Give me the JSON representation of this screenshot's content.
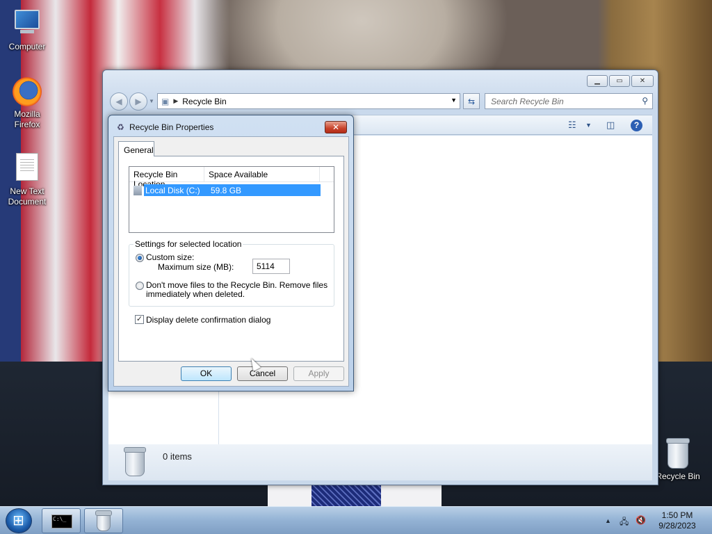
{
  "desktop": {
    "icons": [
      {
        "label": "Computer"
      },
      {
        "label": "Mozilla Firefox"
      },
      {
        "label": "New Text Document"
      },
      {
        "label": "Recycle Bin"
      }
    ]
  },
  "explorer": {
    "address": "Recycle Bin",
    "search_placeholder": "Search Recycle Bin",
    "details": {
      "count": "0 items"
    }
  },
  "dialog": {
    "title": "Recycle Bin Properties",
    "tab": "General",
    "list": {
      "headers": [
        "Recycle Bin Location",
        "Space Available"
      ],
      "rows": [
        {
          "location": "Local Disk (C:)",
          "space": "59.8 GB"
        }
      ]
    },
    "group_label": "Settings for selected location",
    "custom_size_label": "Custom size:",
    "max_size_label": "Maximum size (MB):",
    "max_size_value": "5114",
    "dont_move_label_1": "Don't move files to the Recycle Bin. Remove files",
    "dont_move_label_2": "immediately when deleted.",
    "confirm_label": "Display delete confirmation dialog",
    "buttons": {
      "ok": "OK",
      "cancel": "Cancel",
      "apply": "Apply"
    }
  },
  "taskbar": {
    "time": "1:50 PM",
    "date": "9/28/2023"
  }
}
